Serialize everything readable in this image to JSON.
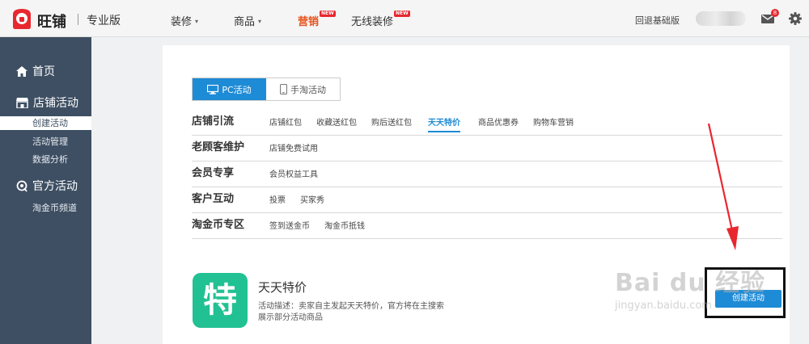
{
  "header": {
    "brand": "旺铺",
    "edition": "专业版",
    "nav": [
      {
        "label": "装修",
        "caret": "▾"
      },
      {
        "label": "商品",
        "caret": "▾"
      },
      {
        "label": "营销",
        "badge": "NEW"
      },
      {
        "label": "无线装修",
        "badge": "NEW"
      }
    ],
    "fallback_link": "回退基础版",
    "mail_count": "8"
  },
  "sidebar": {
    "home": "首页",
    "shop_activity": "店铺活动",
    "sub_items": [
      "创建活动",
      "活动管理",
      "数据分析"
    ],
    "official_activity": "官方活动",
    "official_sub": "淘金币频道"
  },
  "tabs": [
    "PC活动",
    "手淘活动"
  ],
  "categories": [
    {
      "title": "店铺引流",
      "links": [
        "店铺红包",
        "收藏送红包",
        "购后送红包",
        "天天特价",
        "商品优惠券",
        "购物车营销"
      ]
    },
    {
      "title": "老顾客维护",
      "links": [
        "店铺免费试用"
      ]
    },
    {
      "title": "会员专享",
      "links": [
        "会员权益工具"
      ]
    },
    {
      "title": "客户互动",
      "links": [
        "投票",
        "买家秀"
      ]
    },
    {
      "title": "淘金币专区",
      "links": [
        "签到送金币",
        "淘金币抵钱"
      ]
    }
  ],
  "promo": {
    "icon_char": "特",
    "title": "天天特价",
    "description": "活动描述：卖家自主发起天天特价，官方将在主搜索展示部分活动商品",
    "button": "创建活动"
  },
  "watermark": {
    "main": "Bai du 经验",
    "sub": "jingyan.baidu.com"
  },
  "colors": {
    "accent": "#1e8bd6",
    "sidebar": "#3e4f63",
    "promo_green": "#22c193",
    "nav_active": "#e8541b",
    "badge_red": "#e8272f"
  }
}
